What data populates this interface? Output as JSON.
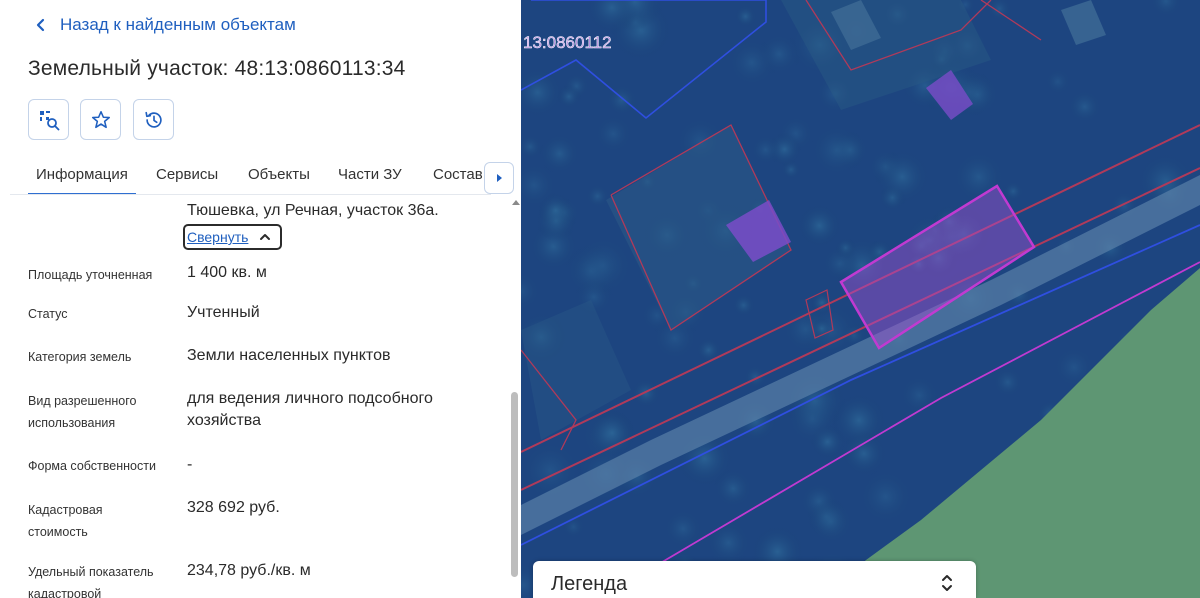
{
  "panel": {
    "back_link": "Назад к найденным объектам",
    "title": "Земельный участок: 48:13:0860113:34",
    "toolbar": [
      {
        "icon": "map-search-icon"
      },
      {
        "icon": "star-icon"
      },
      {
        "icon": "history-icon"
      }
    ],
    "tabs": [
      "Информация",
      "Сервисы",
      "Объекты",
      "Части ЗУ",
      "Состав"
    ],
    "active_tab": "Информация",
    "address_tail": "Тюшевка, ул Речная, участок 36а.",
    "collapse_label": "Свернуть",
    "fields": [
      {
        "label": "Площадь уточненная",
        "value": "1 400 кв. м"
      },
      {
        "label": "Статус",
        "value": "Учтенный"
      },
      {
        "label": "Категория земель",
        "value": "Земли населенных пунктов"
      },
      {
        "label": "Вид разрешенного использования",
        "value": "для ведения личного подсобного хозяйства"
      },
      {
        "label": "Форма собственности",
        "value": "-"
      },
      {
        "label": "Кадастровая стоимость",
        "value": "328 692 руб."
      },
      {
        "label": "Удельный показатель кадастровой",
        "value": "234,78 руб./кв. м"
      }
    ]
  },
  "map": {
    "block_label": "13:0860112",
    "colors": {
      "water": "#5e9673",
      "vegetation": "#1f4d86",
      "parcel_highlight": "#a54fd2",
      "parcel_border": "#c13ad1",
      "boundary_red": "#b03a5a",
      "boundary_blue": "#2f4fe0"
    }
  },
  "legend": {
    "label": "Легенда"
  },
  "colors": {
    "accent": "#1f5fbf",
    "tab_underline": "#2f6fd1"
  }
}
